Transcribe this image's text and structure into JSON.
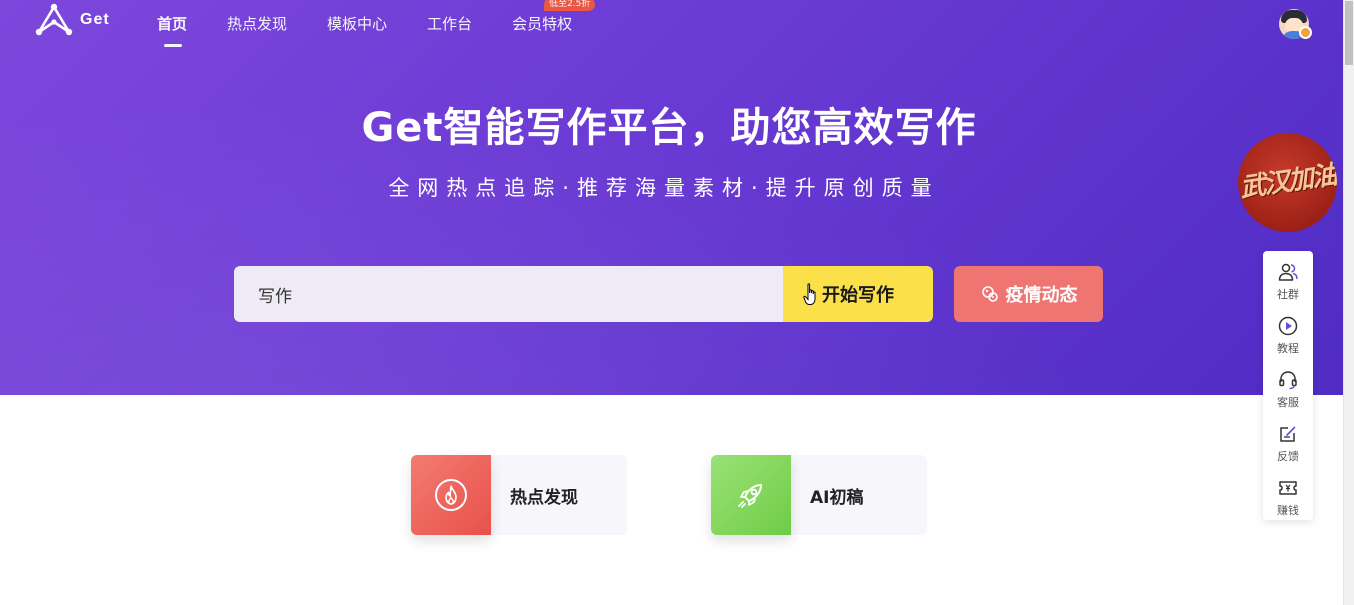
{
  "brand": {
    "logo_text": "Get"
  },
  "nav": {
    "items": [
      {
        "label": "首页"
      },
      {
        "label": "热点发现"
      },
      {
        "label": "模板中心"
      },
      {
        "label": "工作台"
      },
      {
        "label": "会员特权"
      }
    ],
    "active_index": 0,
    "vip_badge": "低至2.5折"
  },
  "hero": {
    "title": "Get智能写作平台，助您高效写作",
    "subtitle": "全网热点追踪·推荐海量素材·提升原创质量",
    "search_value": "写作",
    "start_button": "开始写作",
    "covid_button": "疫情动态"
  },
  "cards": [
    {
      "label": "热点发现",
      "icon": "flame-icon"
    },
    {
      "label": "AI初稿",
      "icon": "rocket-icon"
    }
  ],
  "wuhan_badge": "武汉加油",
  "sidebar": {
    "items": [
      {
        "label": "社群",
        "icon": "community-icon"
      },
      {
        "label": "教程",
        "icon": "play-circle-icon"
      },
      {
        "label": "客服",
        "icon": "headset-icon"
      },
      {
        "label": "反馈",
        "icon": "edit-note-icon"
      },
      {
        "label": "赚钱",
        "icon": "earn-ticket-icon"
      }
    ]
  },
  "colors": {
    "hero_gradient_start": "#7d47dc",
    "hero_gradient_end": "#4f2cc4",
    "start_button": "#fce04a",
    "covid_button": "#ee7572",
    "hot_card": "#e8514b",
    "ai_card": "#6fcc46"
  }
}
